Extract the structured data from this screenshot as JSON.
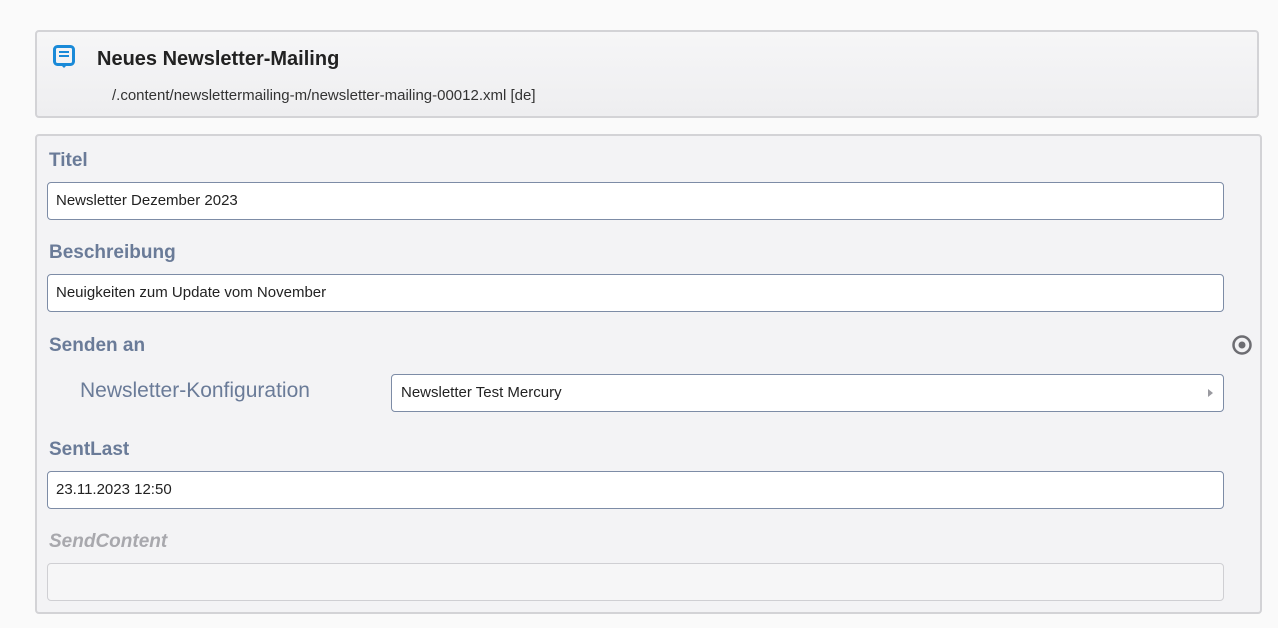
{
  "header": {
    "title": "Neues Newsletter-Mailing",
    "path": "/.content/newslettermailing-m/newsletter-mailing-00012.xml [de]",
    "icon": "newsletter-document-icon"
  },
  "form": {
    "titel": {
      "label": "Titel",
      "value": "Newsletter Dezember 2023"
    },
    "beschreibung": {
      "label": "Beschreibung",
      "value": "Neuigkeiten zum Update vom November"
    },
    "senden_an": {
      "label": "Senden an",
      "sublabel": "Newsletter-Konfiguration",
      "value": "Newsletter Test Mercury",
      "icon": "target-icon"
    },
    "sentlast": {
      "label": "SentLast",
      "value": "23.11.2023 12:50"
    },
    "sendcontent": {
      "label": "SendContent",
      "value": ""
    }
  },
  "colors": {
    "accent": "#1a8ad8",
    "label": "#6a7b98",
    "disabled_label": "#a8a8ad",
    "field_border": "#7d8ca6"
  }
}
